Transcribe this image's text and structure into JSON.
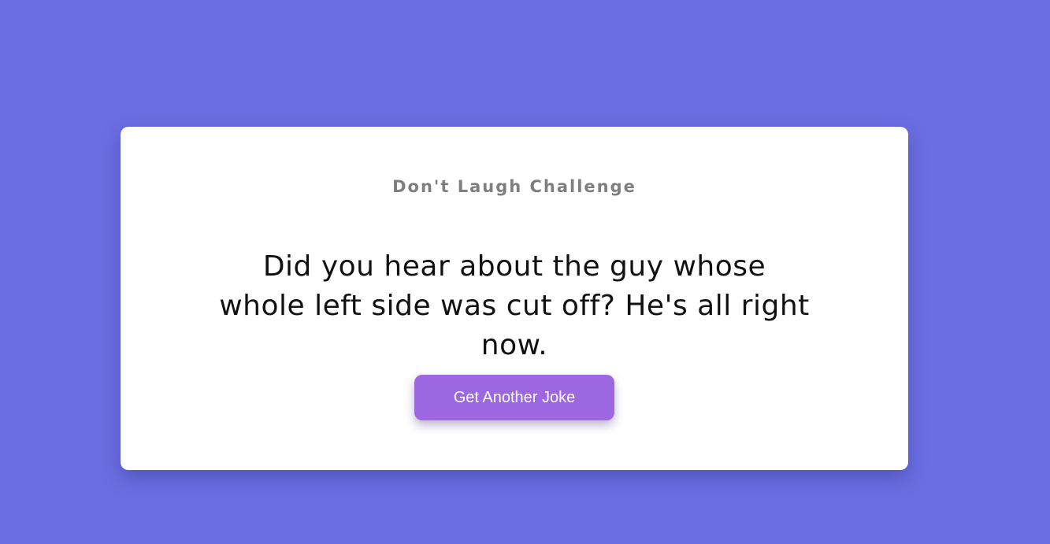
{
  "page": {
    "background_color": "#6a6ee1"
  },
  "card": {
    "title": "Don't Laugh Challenge",
    "joke": "Did you hear about the guy whose whole left side was cut off? He's all right now.",
    "button_label": "Get Another Joke",
    "button_color": "#9c67e0"
  }
}
